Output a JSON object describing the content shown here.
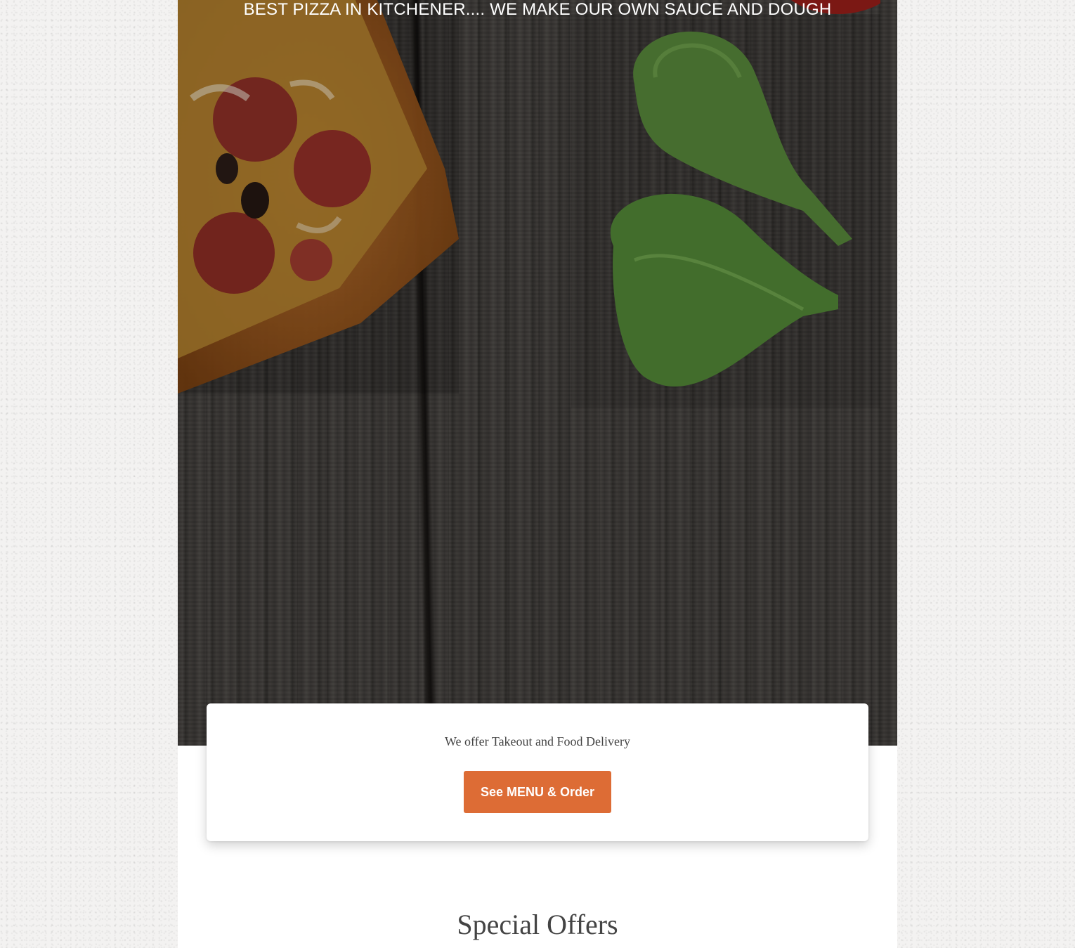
{
  "hero": {
    "tagline": "BEST PIZZA IN KITCHENER.... WE MAKE OUR OWN SAUCE AND DOUGH"
  },
  "cta": {
    "text": "We offer Takeout and Food Delivery",
    "button_label": "See MENU & Order",
    "button_color": "#dd6c35"
  },
  "specials": {
    "title": "Special Offers"
  }
}
